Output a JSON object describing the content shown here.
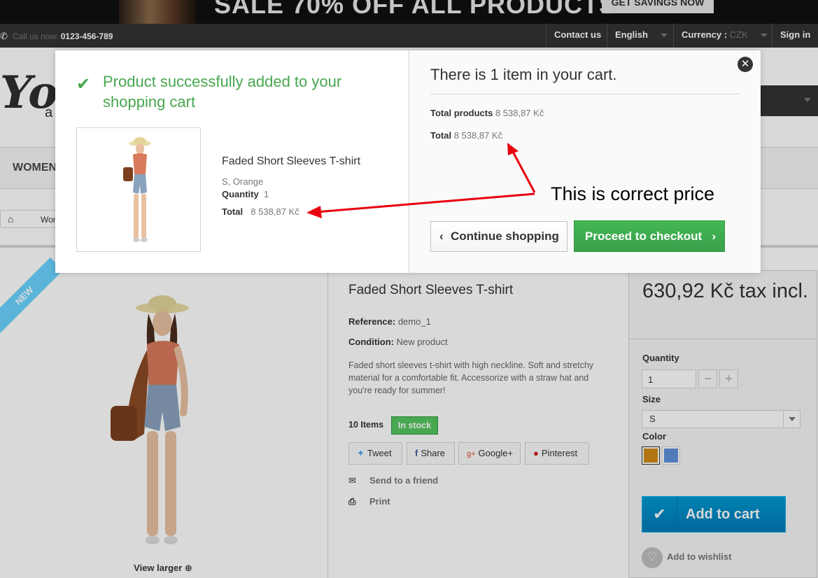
{
  "banner": {
    "text": "SALE 70% OFF ALL PRODUCTS",
    "button_label": "GET SAVINGS NOW"
  },
  "topnav": {
    "call_label": "Call us now:",
    "phone": "0123-456-789",
    "contact": "Contact us",
    "language": "English",
    "currency_label": "Currency :",
    "currency_value": "CZK",
    "sign_in": "Sign in"
  },
  "header": {
    "logo_mark": "Yo",
    "logo_sub": "a",
    "menu_women": "WOMEN",
    "breadcrumb_item": "Wor"
  },
  "product": {
    "badge": "NEW",
    "view_larger": "View larger",
    "title": "Faded Short Sleeves T-shirt",
    "reference_label": "Reference:",
    "reference_value": "demo_1",
    "condition_label": "Condition:",
    "condition_value": "New product",
    "description": "Faded short sleeves t-shirt with high neckline. Soft and stretchy material for a comfortable fit. Accessorize with a straw hat and you're ready for summer!",
    "items_count": "10 Items",
    "stock_status": "In stock",
    "share": {
      "tweet": "Tweet",
      "facebook": "Share",
      "google": "Google+",
      "pinterest": "Pinterest"
    },
    "send_friend": "Send to a friend",
    "print": "Print"
  },
  "buy_box": {
    "price": "630,92 Kč tax incl.",
    "quantity_label": "Quantity",
    "quantity_value": "1",
    "minus": "−",
    "plus": "+",
    "size_label": "Size",
    "size_value": "S",
    "color_label": "Color",
    "colors": [
      "#d08a14",
      "#5f91db"
    ],
    "add_to_cart": "Add to cart",
    "add_to_wishlist": "Add to wishlist"
  },
  "modal": {
    "success_message": "Product successfully added to your shopping cart",
    "product_name": "Faded Short Sleeves T-shirt",
    "attributes": "S, Orange",
    "quantity_label": "Quantity",
    "quantity_value": "1",
    "total_label": "Total",
    "total_value": "8 538,87 Kč",
    "cart_summary": "There is 1 item in your cart.",
    "total_products_label": "Total products",
    "total_products_value": "8 538,87 Kč",
    "cart_total_label": "Total",
    "cart_total_value": "8 538,87 Kč",
    "continue_label": "Continue shopping",
    "checkout_label": "Proceed to checkout"
  },
  "annotation": {
    "text": "This is correct price"
  },
  "colors": {
    "success_green": "#46a74e",
    "checkout_green": "#43b754",
    "cart_blue": "#009ad0",
    "annotation_red": "#e8000e"
  }
}
